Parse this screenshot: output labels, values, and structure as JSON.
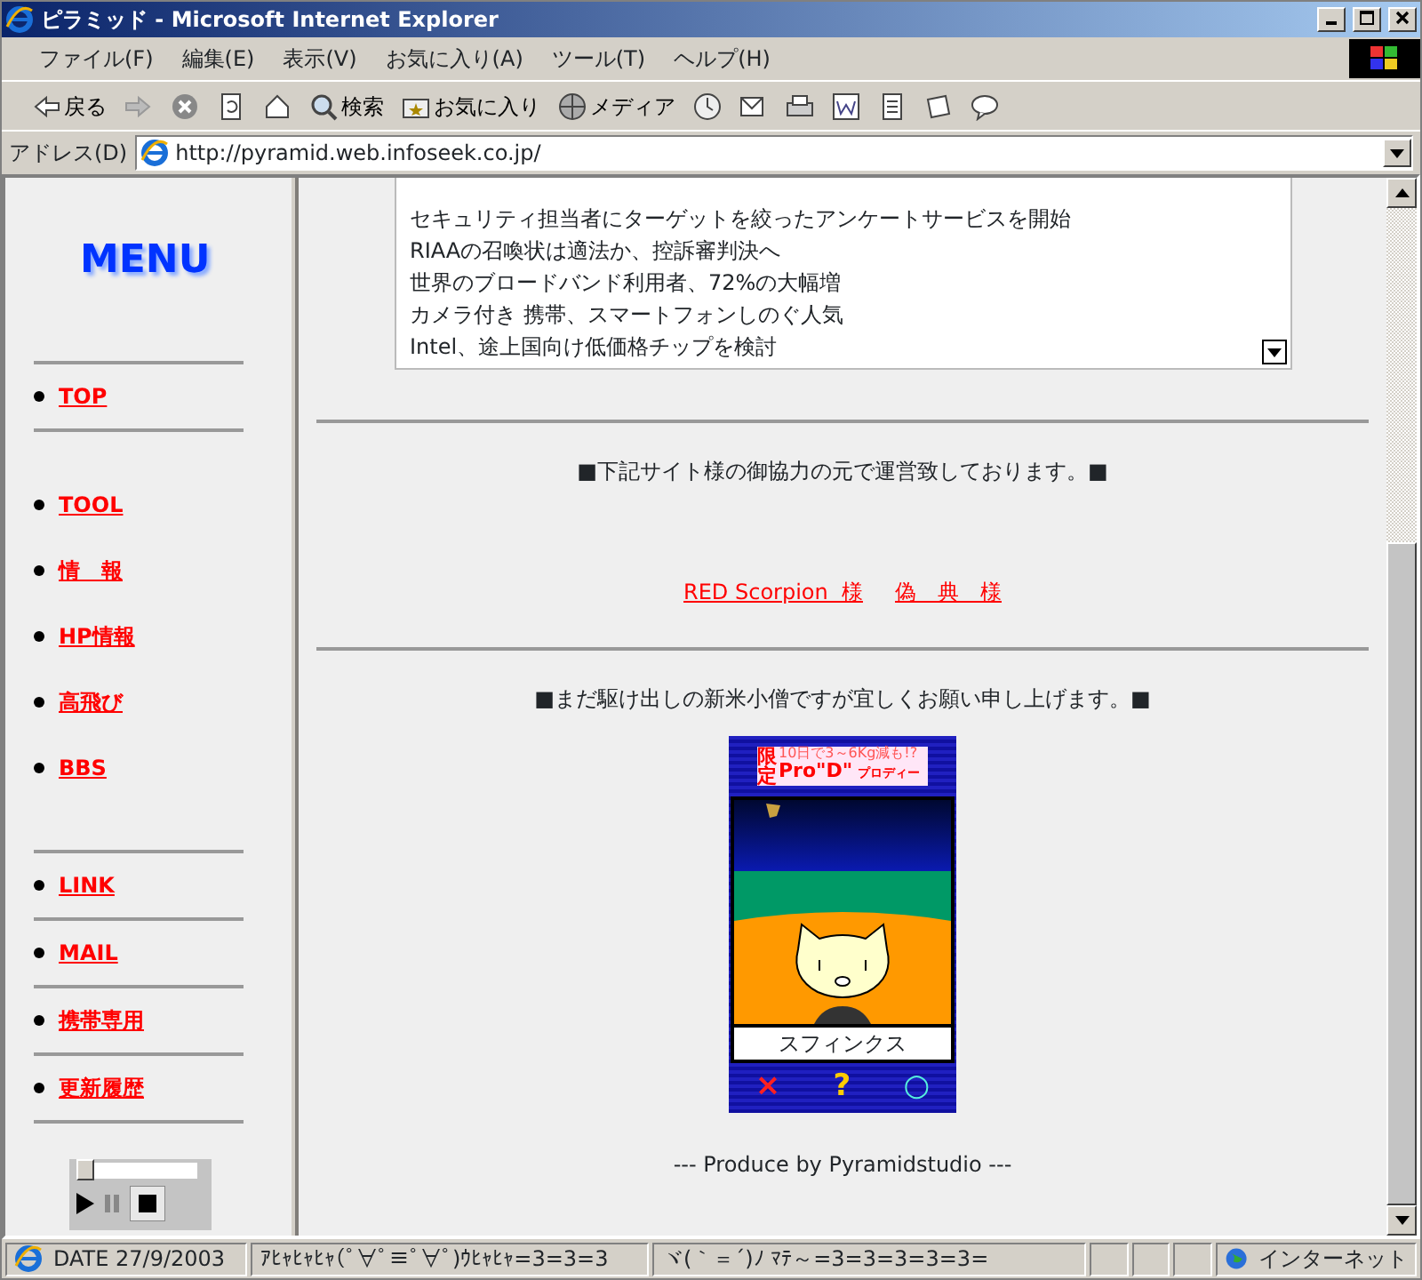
{
  "window": {
    "title": "ピラミッド - Microsoft Internet Explorer"
  },
  "menu": [
    "ファイル(F)",
    "編集(E)",
    "表示(V)",
    "お気に入り(A)",
    "ツール(T)",
    "ヘルプ(H)"
  ],
  "toolbar": [
    {
      "kind": "back",
      "label": "戻る"
    },
    {
      "kind": "forward"
    },
    {
      "kind": "stop"
    },
    {
      "kind": "refresh"
    },
    {
      "kind": "home"
    },
    {
      "kind": "search",
      "label": "検索"
    },
    {
      "kind": "favorites",
      "label": "お気に入り"
    },
    {
      "kind": "media",
      "label": "メディア"
    },
    {
      "kind": "history"
    },
    {
      "kind": "mail"
    },
    {
      "kind": "print"
    },
    {
      "kind": "edit"
    },
    {
      "kind": "discuss"
    },
    {
      "kind": "messenger"
    },
    {
      "kind": "chat"
    }
  ],
  "address": {
    "label": "アドレス(D)",
    "value": "http://pyramid.web.infoseek.co.jp/"
  },
  "sidebar": {
    "title": "MENU",
    "groups": [
      [
        "TOP"
      ],
      [
        "TOOL",
        "情　報",
        "HP情報",
        "高飛び",
        "BBS"
      ],
      [
        "LINK"
      ],
      [
        "MAIL"
      ],
      [
        "携帯専用"
      ],
      [
        "更新履歴"
      ]
    ]
  },
  "player": {
    "level": 0
  },
  "news": [
    "セキュリティ担当者にターゲットを絞ったアンケートサービスを開始",
    "RIAAの召喚状は適法か、控訴審判決へ",
    "世界のブロードバンド利用者、72%の大幅増",
    "カメラ付き 携帯、スマートフォンしのぐ人気",
    "Intel、途上国向け低価格チップを検討"
  ],
  "thanks": {
    "text": "■下記サイト様の御協力の元で運営致しております。■",
    "links": [
      "RED Scorpion  様",
      "偽　典　様"
    ]
  },
  "greeting": "■まだ駆け出しの新米小僧ですが宜しくお願い申し上げます。■",
  "game": {
    "banner_top": "10日で3～6Kg減も!?",
    "banner_left_top": "限",
    "banner_left_bottom": "定",
    "banner_brand": "Pro\"D\"",
    "banner_sub": "プロディー",
    "caption": "スフィンクス",
    "buttons": [
      "×",
      "?",
      "○"
    ]
  },
  "footer": "--- Produce by Pyramidstudio ---",
  "status_bar": {
    "texts": [
      "DATE 27/9/2003",
      "ｱﾋｬﾋｬﾋｬ(ﾟ∀ﾟ≡ﾟ∀ﾟ)ｳﾋｬﾋｬ=3=3=3",
      "ヾ(｀＝´)ﾉ ﾏﾃ～=3=3=3=3=3="
    ],
    "zone": "インターネット"
  }
}
